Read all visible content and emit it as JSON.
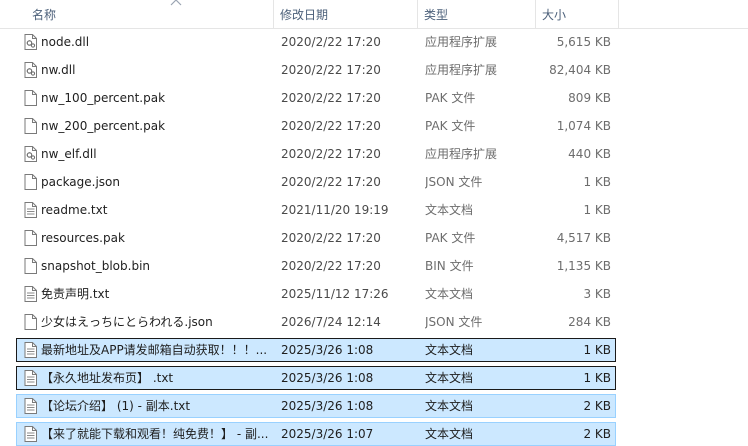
{
  "columns": {
    "name": "名称",
    "date": "修改日期",
    "type": "类型",
    "size": "大小"
  },
  "files": [
    {
      "name": "node.dll",
      "date": "2020/2/22 17:20",
      "type": "应用程序扩展",
      "size": "5,615 KB",
      "icon": "dll-file-icon",
      "state": "normal"
    },
    {
      "name": "nw.dll",
      "date": "2020/2/22 17:20",
      "type": "应用程序扩展",
      "size": "82,404 KB",
      "icon": "dll-file-icon",
      "state": "normal"
    },
    {
      "name": "nw_100_percent.pak",
      "date": "2020/2/22 17:20",
      "type": "PAK 文件",
      "size": "809 KB",
      "icon": "generic-file-icon",
      "state": "normal"
    },
    {
      "name": "nw_200_percent.pak",
      "date": "2020/2/22 17:20",
      "type": "PAK 文件",
      "size": "1,074 KB",
      "icon": "generic-file-icon",
      "state": "normal"
    },
    {
      "name": "nw_elf.dll",
      "date": "2020/2/22 17:20",
      "type": "应用程序扩展",
      "size": "440 KB",
      "icon": "dll-file-icon",
      "state": "normal"
    },
    {
      "name": "package.json",
      "date": "2020/2/22 17:20",
      "type": "JSON 文件",
      "size": "1 KB",
      "icon": "generic-file-icon",
      "state": "normal"
    },
    {
      "name": "readme.txt",
      "date": "2021/11/20 19:19",
      "type": "文本文档",
      "size": "1 KB",
      "icon": "text-file-icon",
      "state": "normal"
    },
    {
      "name": "resources.pak",
      "date": "2020/2/22 17:20",
      "type": "PAK 文件",
      "size": "4,517 KB",
      "icon": "generic-file-icon",
      "state": "normal"
    },
    {
      "name": "snapshot_blob.bin",
      "date": "2020/2/22 17:20",
      "type": "BIN 文件",
      "size": "1,135 KB",
      "icon": "generic-file-icon",
      "state": "normal"
    },
    {
      "name": "免责声明.txt",
      "date": "2025/11/12 17:26",
      "type": "文本文档",
      "size": "3 KB",
      "icon": "text-file-icon",
      "state": "normal"
    },
    {
      "name": "少女はえっちにとらわれる.json",
      "date": "2026/7/24 12:14",
      "type": "JSON 文件",
      "size": "284 KB",
      "icon": "generic-file-icon",
      "state": "normal"
    },
    {
      "name": "最新地址及APP请发邮箱自动获取！！！...",
      "date": "2025/3/26 1:08",
      "type": "文本文档",
      "size": "1 KB",
      "icon": "text-file-icon",
      "state": "focused"
    },
    {
      "name": "【永久地址发布页】 .txt",
      "date": "2025/3/26 1:08",
      "type": "文本文档",
      "size": "1 KB",
      "icon": "text-file-icon",
      "state": "focused"
    },
    {
      "name": "【论坛介绍】 (1) - 副本.txt",
      "date": "2025/3/26 1:08",
      "type": "文本文档",
      "size": "2 KB",
      "icon": "text-file-icon",
      "state": "selected"
    },
    {
      "name": "【来了就能下载和观看！纯免费！】 - 副...",
      "date": "2025/3/26 1:07",
      "type": "文本文档",
      "size": "2 KB",
      "icon": "text-file-icon",
      "state": "selected"
    }
  ]
}
